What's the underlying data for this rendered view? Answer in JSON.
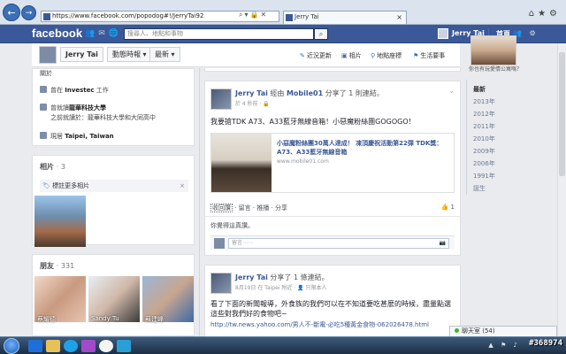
{
  "browser": {
    "url": "https://www.facebook.com/popodog#!/JerryTai92",
    "tab_title": "Jerry Tai"
  },
  "fb": {
    "logo": "facebook",
    "search_placeholder": "搜尋人、地點和事物",
    "user_name": "Jerry Tai",
    "home_label": "首頁"
  },
  "subnav": {
    "name": "Jerry Tai",
    "timeline_label": "動態時報 ▾",
    "recent_label": "最新 ▾",
    "links": [
      "近況更新",
      "相片",
      "地點座標",
      "生活要事"
    ]
  },
  "about": {
    "top_fragment": "關於",
    "work": {
      "prefix": "曾在",
      "company": "Investec",
      "suffix": "工作"
    },
    "school": {
      "prefix": "曾就讀",
      "name": "龍華科技大學",
      "sub": "之前就讀於：龍華科技大學和大同高中"
    },
    "city": {
      "prefix": "現居",
      "name": "Taipei, Taiwan"
    }
  },
  "photos": {
    "title": "相片",
    "count": "· 3",
    "tag_label": "標註更多相片",
    "close": "×"
  },
  "friends": {
    "title": "朋友",
    "count": "· 331",
    "names": [
      "蔡耀德",
      "Sandy Tu",
      "蘇建峰"
    ]
  },
  "post1": {
    "author": "Jerry Tai",
    "via_text": "經由",
    "via_app": "Mobile01",
    "shared_text": "分享了 1 則連結。",
    "meta": "於 4 秒前 · 🔒",
    "chevron": "⌄",
    "text": "我要搶TDK A73、A33藍牙無線音箱！小惡魔粉絲團GOGOGO！",
    "link_title": "小惡魔粉絲團30萬人達成！ 凍頂慶祝活動第22彈 TDK獎：A73、A33藍牙無線音箱",
    "link_domain": "www.mobile01.com",
    "actions_pre": "收回讚",
    "actions_rest": " · 留言 · 推播 · 分享",
    "like_count": "👍 1",
    "likes_text": "你覺得這真讚。",
    "comment_placeholder": "留言⋯⋯",
    "camera": "📷"
  },
  "post2": {
    "author": "Jerry Tai",
    "shared_text": "分享了 1 條連結。",
    "meta": "8月19日 在 Taipei 附近 · 👤 只限本人",
    "text_line1": "看了下面的新聞報導，外食族的我們可以在不知道要吃甚麼的時候，盡量點選",
    "text_line2": "這些對我們好的食物吧~",
    "url": "http://tw.news.yahoo.com/男人不-斷電-必吃5種黃金食物-062026478.html"
  },
  "right": {
    "caption": "你也有玩愛情公寓嗎？",
    "years": [
      "最新",
      "2013年",
      "2012年",
      "2011年",
      "2010年",
      "2009年",
      "2006年",
      "1991年",
      "誕生"
    ]
  },
  "chat": {
    "label": "聊天室 (54)"
  },
  "watermark": "#368974"
}
